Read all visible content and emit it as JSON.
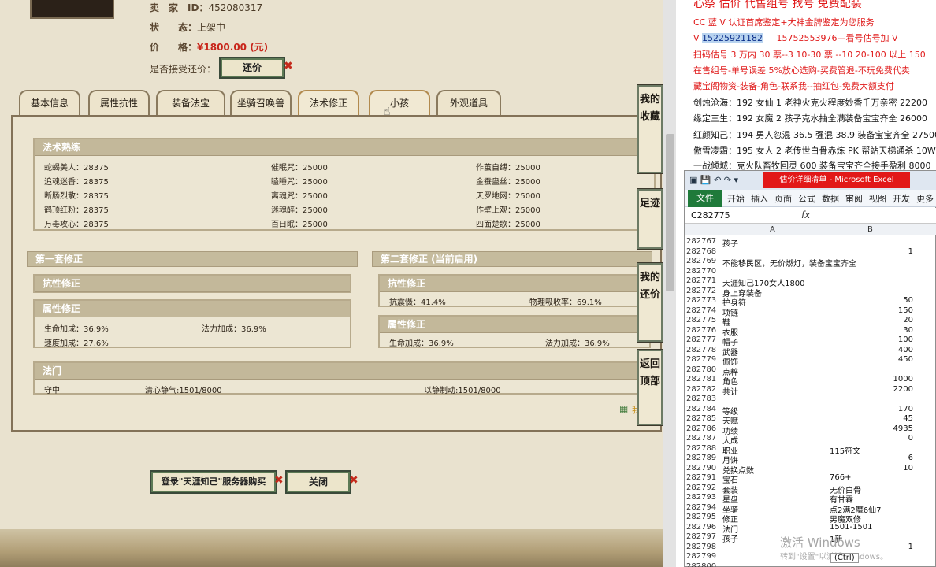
{
  "left": {
    "seller_id_label": "卖　家　ID：",
    "seller_id": "452080317",
    "status_label": "状　　态：",
    "status": "上架中",
    "price_label": "价　　格：",
    "price": "¥1800.00 (元)",
    "counter_label": "是否接受还价：",
    "counter_btn": "还价",
    "tabs": [
      "基本信息",
      "属性抗性",
      "装备法宝",
      "坐骑召唤兽",
      "法术修正",
      "小孩",
      "外观道具"
    ],
    "spell_title": "法术熟练",
    "spells": [
      [
        "蛇蝎美人：28375",
        "催眠咒：25000",
        "作茧自缚：25000"
      ],
      [
        "追魂迷香：28375",
        "瞌睡咒：25000",
        "金蚕蛊丝：25000"
      ],
      [
        "断肠烈散：28375",
        "离魂咒：25000",
        "天罗地网：25000"
      ],
      [
        "鹤顶红粉：28375",
        "迷魂醉：25000",
        "作壁上观：25000"
      ],
      [
        "万毒攻心：28375",
        "百日眠：25000",
        "四面楚歌：25000"
      ]
    ],
    "set1_title": "第一套修正",
    "set2_title": "第二套修正 (当前启用)",
    "resist_title": "抗性修正",
    "attr_title": "属性修正",
    "set1_attrs": [
      "生命加成：36.9%",
      "法力加成：36.9%",
      "速度加成：27.6%"
    ],
    "set2_resist": [
      "抗震慑：41.4%",
      "物理吸收率：69.1%"
    ],
    "set2_attrs": [
      "生命加成：36.9%",
      "法力加成：36.9%"
    ],
    "fa_title": "法门",
    "fa": [
      "守中",
      "清心静气:1501/8000",
      "以静制动:1501/8000"
    ],
    "side_buttons": [
      "我的收藏",
      "足迹",
      "我的还价",
      "返回顶部"
    ],
    "login_btn": "登录\"天涯知己\"服务器购买",
    "close_btn": "关闭",
    "cut_text": "我"
  },
  "right": {
    "ads": [
      {
        "text": "心祭 估价 代售组号 找号 免费配装",
        "color": "red"
      },
      {
        "text": "CC 蓝 V 认证首席鉴定+大神金牌鉴定为您服务",
        "color": "red"
      },
      {
        "text": "扫码估号 3 万内 30 票--3 10-30 票 --10 20-100 以上 150",
        "color": "red"
      },
      {
        "text": "在售组号-单号误差 5%放心选购-买费管退-不玩免费代卖",
        "color": "red"
      },
      {
        "text": "藏宝阁物资-装备-角色-联系我--抽红包-免费大额支付",
        "color": "red"
      },
      {
        "text": "剑烛沧海：192 女仙 1 老神火克火程度妙香千万亲密 22200",
        "color": "black"
      },
      {
        "text": "缘定三生：192 女魔 2 孩子克水抽全满装备宝宝齐全 26000",
        "color": "black"
      },
      {
        "text": "红颜知己：194 男人忽混 36.5 强混 38.9 装备宝宝齐全 27500",
        "color": "black"
      },
      {
        "text": "傲雪凌霜：195 女人 2 老传世白骨赤炼 PK 帮站天梯通杀 10W",
        "color": "black"
      },
      {
        "text": "一战倾城：克火队畜牧回灵 600 装备宝宝齐全接手盈利 8000",
        "color": "black"
      }
    ],
    "phone_prefix": "V",
    "phone1": "15225921182",
    "phone2": "15752553976—看号估号加 V",
    "excel": {
      "title": "估价详细清单 - Microsoft Excel",
      "ribbon_tabs": [
        "文件",
        "开始",
        "插入",
        "页面",
        "公式",
        "数据",
        "审阅",
        "视图",
        "开发",
        "更多"
      ],
      "name_box": "C282775",
      "fx": "fx",
      "col_a": "A",
      "col_b": "B",
      "rows": [
        [
          "282767",
          "孩子",
          ""
        ],
        [
          "282768",
          "",
          "1"
        ],
        [
          "282769",
          "不能移民区，无价燃灯，装备宝宝齐全",
          ""
        ],
        [
          "282770",
          "",
          ""
        ],
        [
          "282771",
          "天涯知己170女人1800",
          ""
        ],
        [
          "282772",
          "身上穿装备",
          ""
        ],
        [
          "282773",
          "护身符",
          "50"
        ],
        [
          "282774",
          "项链",
          "150"
        ],
        [
          "282775",
          "鞋",
          "20"
        ],
        [
          "282776",
          "衣服",
          "30"
        ],
        [
          "282777",
          "帽子",
          "100"
        ],
        [
          "282778",
          "武器",
          "400"
        ],
        [
          "282779",
          "佩饰",
          "450"
        ],
        [
          "282780",
          "点粹",
          ""
        ],
        [
          "282781",
          "角色",
          "1000"
        ],
        [
          "282782",
          "共计",
          "2200"
        ],
        [
          "282783",
          "",
          ""
        ],
        [
          "282784",
          "等级",
          "170"
        ],
        [
          "282785",
          "天赋",
          "45"
        ],
        [
          "282786",
          "功绩",
          "4935"
        ],
        [
          "282787",
          "大成",
          "0"
        ],
        [
          "282788",
          "职业",
          "115符文"
        ],
        [
          "282789",
          "月饼",
          "6"
        ],
        [
          "282790",
          "兑换点数",
          "10"
        ],
        [
          "282791",
          "宝石",
          "766+"
        ],
        [
          "282792",
          "套装",
          "无价白骨"
        ],
        [
          "282793",
          "星盘",
          "有甘霖"
        ],
        [
          "282794",
          "坐骑",
          "点2满2魔6仙7"
        ],
        [
          "282795",
          "修正",
          "男魔双修"
        ],
        [
          "282796",
          "法门",
          "1501-1501"
        ],
        [
          "282797",
          "孩子",
          "1新"
        ],
        [
          "282798",
          "",
          "1"
        ],
        [
          "282799",
          "",
          ""
        ],
        [
          "282800",
          "",
          ""
        ]
      ]
    },
    "watermark1": "激活 Windows",
    "watermark2": "转到\"设置\"以激活 Windows。",
    "ctrl_tag": "(Ctrl)"
  }
}
